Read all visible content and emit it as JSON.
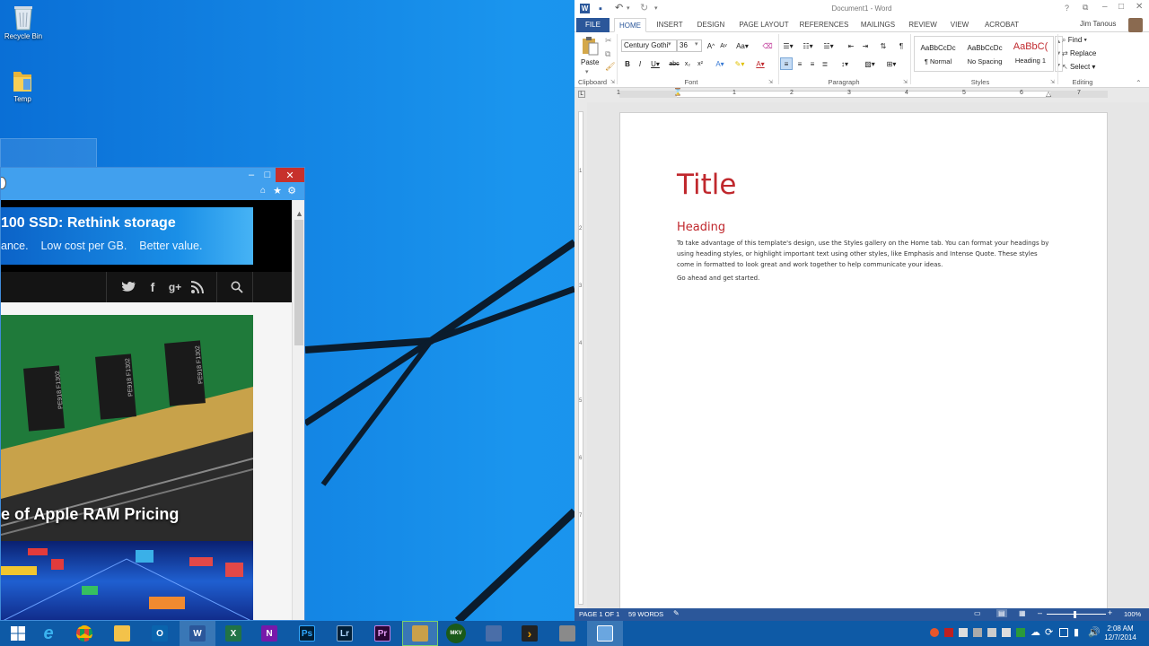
{
  "desktop": {
    "icons": [
      {
        "label": "Recycle Bin",
        "icon": "recycle-bin-icon"
      },
      {
        "label": "Temp",
        "icon": "folder-icon"
      }
    ]
  },
  "browser": {
    "ad": {
      "headline": "100 SSD: Rethink storage",
      "tagline": "ance.    Low cost per GB.    Better value."
    },
    "articles": [
      {
        "title": "e of Apple RAM Pricing",
        "chip_labels": [
          "PE918 F1302",
          "PE918 F1302",
          "PE918 F1302"
        ]
      }
    ]
  },
  "word": {
    "title": "Document1 - Word",
    "user": "Jim Tanous",
    "tabs": [
      "FILE",
      "HOME",
      "INSERT",
      "DESIGN",
      "PAGE LAYOUT",
      "REFERENCES",
      "MAILINGS",
      "REVIEW",
      "VIEW",
      "ACROBAT"
    ],
    "active_tab": "HOME",
    "font_name": "Century Gothi",
    "font_size": "36",
    "paste_label": "Paste",
    "styles": [
      {
        "preview": "AaBbCcDc",
        "label": "¶ Normal"
      },
      {
        "preview": "AaBbCcDc",
        "label": "No Spacing"
      },
      {
        "preview": "AaBbC(",
        "label": "Heading 1"
      }
    ],
    "editing": [
      "Find",
      "Replace",
      "Select"
    ],
    "groups": [
      "Clipboard",
      "Font",
      "Paragraph",
      "Styles",
      "Editing"
    ],
    "ruler_numbers": [
      "1",
      "1",
      "2",
      "3",
      "4",
      "5",
      "6",
      "7"
    ],
    "vruler_numbers": [
      "1",
      "2",
      "3",
      "4",
      "5",
      "6",
      "7"
    ],
    "document": {
      "title": "Title",
      "heading": "Heading",
      "body": "To take advantage of this template's design, use the Styles gallery on the Home tab. You can format your headings by using heading styles, or highlight important text using other styles, like Emphasis and Intense Quote. These styles come in formatted to look great and work together to help communicate your ideas.",
      "second": "Go ahead and get started."
    },
    "status": {
      "page": "PAGE 1 OF 1",
      "words": "59 WORDS",
      "zoom": "100%"
    },
    "accent": "#2b579a",
    "title_color": "#c0282d"
  },
  "taskbar": {
    "items": [
      {
        "icon": "ie-icon",
        "label": "e"
      },
      {
        "icon": "chrome-icon",
        "label": ""
      },
      {
        "icon": "file-explorer-icon",
        "label": ""
      },
      {
        "icon": "outlook-icon",
        "label": "O"
      },
      {
        "icon": "word-icon",
        "label": "W"
      },
      {
        "icon": "excel-icon",
        "label": "X"
      },
      {
        "icon": "onenote-icon",
        "label": "N"
      },
      {
        "icon": "photoshop-icon",
        "label": "Ps"
      },
      {
        "icon": "lightroom-icon",
        "label": "Lr"
      },
      {
        "icon": "premiere-icon",
        "label": "Pr"
      },
      {
        "icon": "app-icon",
        "label": ""
      },
      {
        "icon": "mkv-icon",
        "label": "MKV"
      },
      {
        "icon": "network-app-icon",
        "label": ""
      },
      {
        "icon": "plex-icon",
        "label": "›"
      },
      {
        "icon": "tools-icon",
        "label": ""
      },
      {
        "icon": "remote-app-icon",
        "label": ""
      }
    ],
    "time": "2:08 AM",
    "date": "12/7/2014"
  }
}
